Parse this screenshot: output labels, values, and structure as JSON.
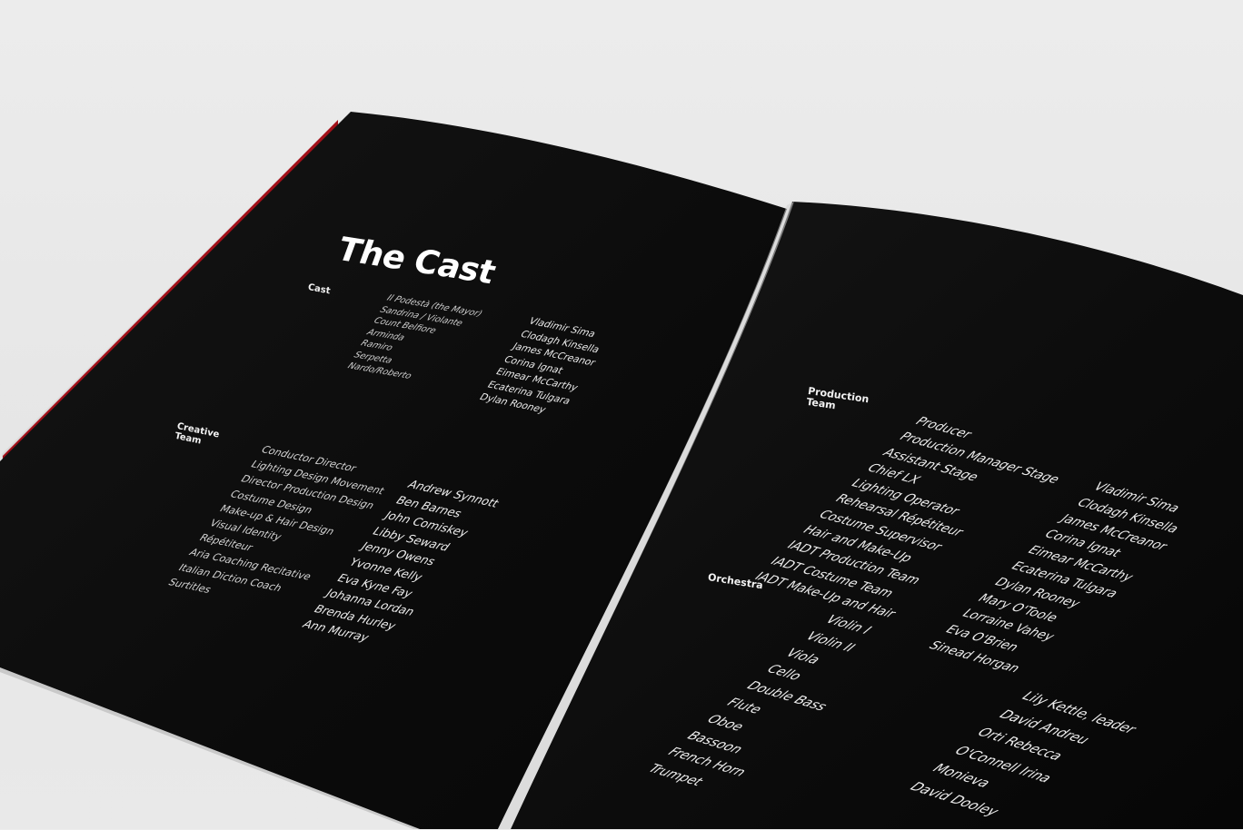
{
  "left_page": {
    "title": "The Cast",
    "cast": {
      "heading": "Cast",
      "roles": [
        "Il Podestà (the Mayor)",
        "Sandrina / Violante",
        "Count Belfiore",
        "Arminda",
        "Ramiro",
        "Serpetta",
        "Nardo/Roberto"
      ],
      "names": [
        "Vladimir Sima",
        "Clodagh Kinsella",
        "James McCreanor",
        "Corina Ignat",
        "Eimear  McCarthy",
        "Ecaterina Tulgara",
        "Dylan Rooney"
      ]
    },
    "creative_team": {
      "heading_line1": "Creative",
      "heading_line2": "Team",
      "roles": [
        "Conductor Director",
        "Lighting Design Movement",
        "Director Production Design",
        "Costume Design",
        "Make-up & Hair Design",
        "Visual Identity",
        "Répétiteur",
        "Aria Coaching Recitative",
        "Italian Diction Coach",
        "Surtitles"
      ],
      "names": [
        "Andrew Synnott",
        "Ben Barnes",
        "John Comiskey",
        "Libby Seward",
        "Jenny Owens",
        "Yvonne Kelly",
        "Eva Kyne Fay",
        "Johanna Lordan",
        "Brenda Hurley",
        "Ann Murray"
      ]
    }
  },
  "right_page": {
    "production_team": {
      "heading_line1": "Production",
      "heading_line2": "Team",
      "roles": [
        "Producer",
        "Production Manager Stage",
        "Assistant Stage",
        "Chief LX",
        "Lighting Operator",
        "Rehearsal Répétiteur",
        "Costume Supervisor",
        "Hair and Make-Up",
        "IADT Production Team",
        "IADT Costume Team",
        "IADT Make-Up and Hair"
      ],
      "names": [
        "Vladimir Sima",
        "Clodagh Kinsella",
        "James McCreanor",
        "Corina Ignat",
        "Eimear  McCarthy",
        "Ecaterina Tulgara",
        "Dylan Rooney",
        "Mary O'Toole",
        "Lorraine Vahey",
        "Eva O'Brien",
        "Sinead Horgan"
      ]
    },
    "orchestra": {
      "heading": "Orchestra",
      "instruments": [
        "Violin I",
        "Violin II",
        "Viola",
        "Cello",
        "Double Bass",
        "Flute",
        "Oboe",
        "Bassoon",
        "French Horn",
        "Trumpet"
      ],
      "names": [
        "Lily Kettle, leader",
        "David Andreu",
        "Orti Rebecca",
        "O'Connell Irina",
        "Monieva",
        "David Dooley"
      ]
    }
  },
  "colors": {
    "page": "#0b0b0b",
    "background": "#e8e8e8",
    "text": "#eeeeee",
    "spine_accent": "#b3121b"
  }
}
